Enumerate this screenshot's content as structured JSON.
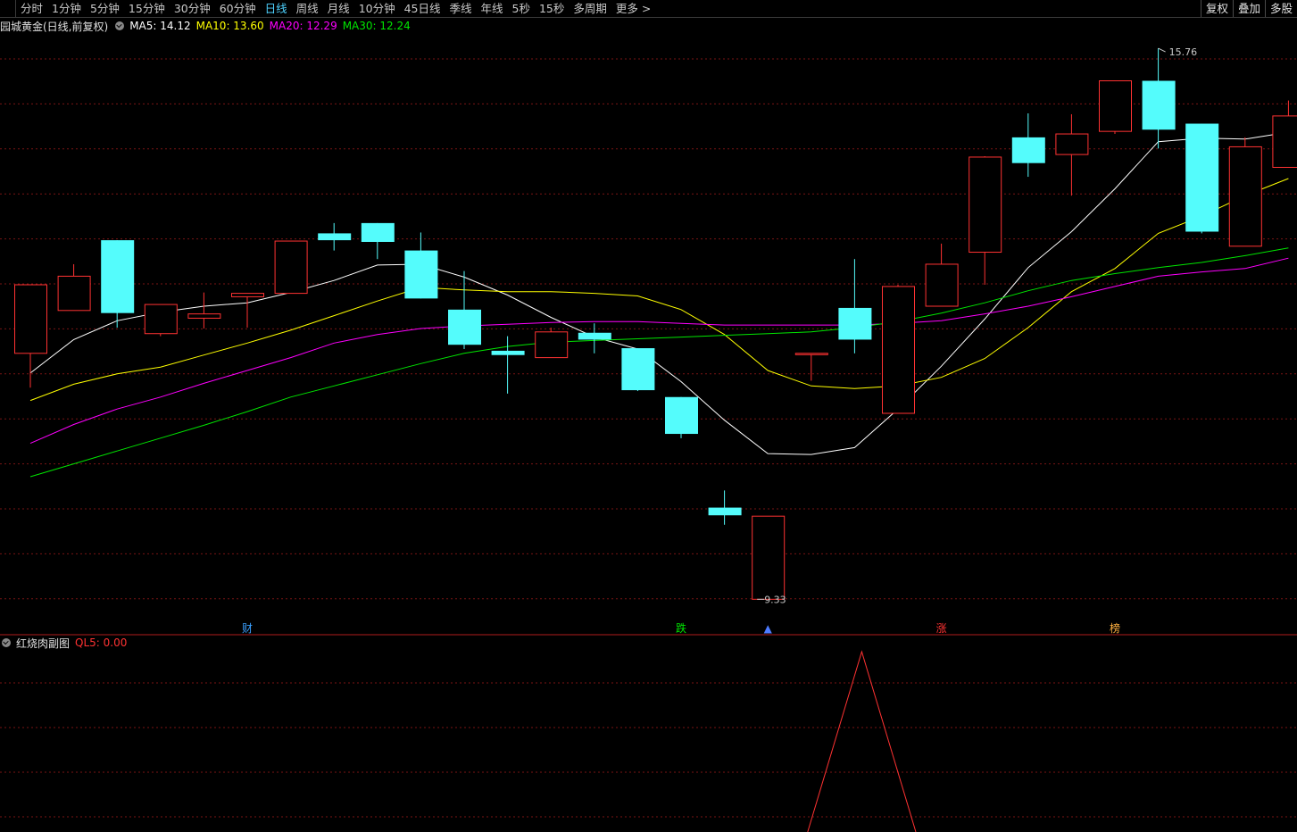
{
  "toolbar": {
    "periods": [
      "分时",
      "1分钟",
      "5分钟",
      "15分钟",
      "30分钟",
      "60分钟",
      "日线",
      "周线",
      "月线",
      "10分钟",
      "45日线",
      "季线",
      "年线",
      "5秒",
      "15秒",
      "多周期",
      "更多 >"
    ],
    "selected_index": 6,
    "right_buttons": [
      "复权",
      "叠加",
      "多股"
    ]
  },
  "info": {
    "title": "园城黄金(日线,前复权)",
    "ma5": "MA5: 14.12",
    "ma10": "MA10: 13.60",
    "ma20": "MA20: 12.29",
    "ma30": "MA30: 12.24"
  },
  "sub": {
    "title": "红烧肉副图",
    "ql5": "QL5: 0.00"
  },
  "colors": {
    "up": "#ff3232",
    "down": "#54fcfc",
    "ma5": "#ffffff",
    "ma10": "#ffff00",
    "ma20": "#ff00ff",
    "ma30": "#00e600",
    "grid": "#7a1414",
    "selected": "#4ed2ff"
  },
  "chart_data": {
    "type": "candlestick",
    "ylim": [
      9.0,
      16.0
    ],
    "high_label": "15.76",
    "low_label": "9.33",
    "candles": [
      {
        "o": 12.2,
        "h": 13.0,
        "l": 11.8,
        "c": 13.0
      },
      {
        "o": 12.7,
        "h": 13.24,
        "l": 12.7,
        "c": 13.1
      },
      {
        "o": 13.52,
        "h": 13.52,
        "l": 12.5,
        "c": 12.67
      },
      {
        "o": 12.43,
        "h": 12.73,
        "l": 12.4,
        "c": 12.77
      },
      {
        "o": 12.61,
        "h": 12.91,
        "l": 12.49,
        "c": 12.66
      },
      {
        "o": 12.86,
        "h": 12.86,
        "l": 12.5,
        "c": 12.9
      },
      {
        "o": 12.9,
        "h": 13.5,
        "l": 12.9,
        "c": 13.51
      },
      {
        "o": 13.6,
        "h": 13.72,
        "l": 13.4,
        "c": 13.52
      },
      {
        "o": 13.72,
        "h": 13.72,
        "l": 13.3,
        "c": 13.5
      },
      {
        "o": 13.4,
        "h": 13.61,
        "l": 12.84,
        "c": 12.84
      },
      {
        "o": 12.71,
        "h": 13.16,
        "l": 12.25,
        "c": 12.3
      },
      {
        "o": 12.23,
        "h": 12.4,
        "l": 11.73,
        "c": 12.18
      },
      {
        "o": 12.15,
        "h": 12.5,
        "l": 12.5,
        "c": 12.45
      },
      {
        "o": 12.44,
        "h": 12.55,
        "l": 12.2,
        "c": 12.36
      },
      {
        "o": 12.26,
        "h": 12.26,
        "l": 11.76,
        "c": 11.77
      },
      {
        "o": 11.69,
        "h": 11.49,
        "l": 11.21,
        "c": 11.26
      },
      {
        "o": 10.4,
        "h": 10.6,
        "l": 10.2,
        "c": 10.31
      },
      {
        "o": 9.33,
        "h": 10.3,
        "l": 9.33,
        "c": 10.3
      },
      {
        "o": 12.2,
        "h": 12.2,
        "l": 11.88,
        "c": 12.2
      },
      {
        "o": 12.73,
        "h": 13.3,
        "l": 12.2,
        "c": 12.36
      },
      {
        "o": 11.5,
        "h": 13.0,
        "l": 11.5,
        "c": 12.98
      },
      {
        "o": 12.75,
        "h": 13.48,
        "l": 12.75,
        "c": 13.24
      },
      {
        "o": 13.38,
        "h": 14.5,
        "l": 13.0,
        "c": 14.49
      },
      {
        "o": 14.72,
        "h": 15.0,
        "l": 14.26,
        "c": 14.42
      },
      {
        "o": 14.52,
        "h": 14.99,
        "l": 14.04,
        "c": 14.76
      },
      {
        "o": 14.79,
        "h": 15.38,
        "l": 14.76,
        "c": 15.38
      },
      {
        "o": 15.38,
        "h": 15.76,
        "l": 14.59,
        "c": 14.81
      },
      {
        "o": 14.88,
        "h": 14.88,
        "l": 13.6,
        "c": 13.62
      },
      {
        "o": 13.45,
        "h": 14.72,
        "l": 13.45,
        "c": 14.61
      },
      {
        "o": 14.37,
        "h": 15.15,
        "l": 14.37,
        "c": 14.97
      }
    ],
    "series": [
      {
        "name": "MA5",
        "values": [
          11.97,
          12.36,
          12.58,
          12.68,
          12.75,
          12.79,
          12.91,
          13.05,
          13.23,
          13.24,
          13.09,
          12.88,
          12.62,
          12.39,
          12.25,
          11.87,
          11.42,
          11.03,
          11.02,
          11.1,
          11.55,
          12.05,
          12.6,
          13.2,
          13.62,
          14.12,
          14.67,
          14.71,
          14.7,
          14.78
        ]
      },
      {
        "name": "MA10",
        "values": [
          11.65,
          11.84,
          11.96,
          12.04,
          12.18,
          12.32,
          12.47,
          12.64,
          12.81,
          12.97,
          12.94,
          12.92,
          12.92,
          12.9,
          12.87,
          12.71,
          12.42,
          12.0,
          11.82,
          11.79,
          11.82,
          11.92,
          12.14,
          12.5,
          12.92,
          13.19,
          13.6,
          13.8,
          14.04,
          14.24
        ]
      },
      {
        "name": "MA20",
        "values": [
          11.15,
          11.37,
          11.55,
          11.69,
          11.85,
          12.0,
          12.15,
          12.32,
          12.42,
          12.49,
          12.52,
          12.54,
          12.56,
          12.57,
          12.57,
          12.55,
          12.53,
          12.53,
          12.53,
          12.53,
          12.55,
          12.58,
          12.66,
          12.75,
          12.86,
          12.98,
          13.1,
          13.15,
          13.19,
          13.31
        ]
      },
      {
        "name": "MA30",
        "values": [
          10.76,
          10.91,
          11.06,
          11.21,
          11.36,
          11.52,
          11.69,
          11.82,
          11.95,
          12.08,
          12.2,
          12.28,
          12.33,
          12.35,
          12.37,
          12.39,
          12.41,
          12.43,
          12.45,
          12.5,
          12.57,
          12.67,
          12.79,
          12.93,
          13.05,
          13.13,
          13.2,
          13.26,
          13.34,
          13.43
        ]
      }
    ],
    "events": [
      {
        "label": "财",
        "index": 5,
        "color": "#3aa0ff"
      },
      {
        "label": "跌",
        "index": 15,
        "color": "#00e600"
      },
      {
        "label": "▲",
        "index": 17,
        "color": "#4d7bff"
      },
      {
        "label": "涨",
        "index": 21,
        "color": "#ff3232"
      },
      {
        "label": "榜",
        "index": 25,
        "color": "#ffb040"
      }
    ],
    "sub_panel": {
      "peak_index": 19,
      "peak_value": 1.0,
      "spread": 1
    }
  }
}
